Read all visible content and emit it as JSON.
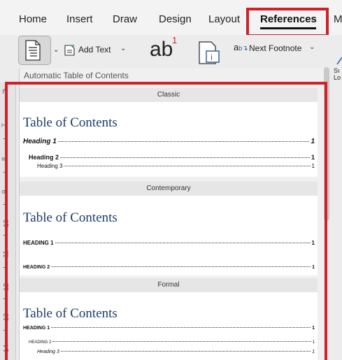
{
  "ribbon": {
    "tabs": [
      {
        "label": "Home"
      },
      {
        "label": "Insert"
      },
      {
        "label": "Draw"
      },
      {
        "label": "Design"
      },
      {
        "label": "Layout"
      },
      {
        "label": "References",
        "active": true
      },
      {
        "label": "M"
      }
    ],
    "add_text_label": "Add Text",
    "footnote_glyph": "ab",
    "footnote_superscript": "1",
    "next_footnote_label": "Next Footnote",
    "cut_off_text": "Sı\nLo"
  },
  "gallery": {
    "header": "Automatic Table of Contents",
    "ruler_numbers": [
      "7",
      "8",
      "9",
      "10",
      "11",
      "12",
      "13",
      "14"
    ],
    "styles": [
      {
        "label": "Classic",
        "title": "Table of Contents",
        "entries": [
          {
            "text": "Heading 1",
            "page": "1"
          },
          {
            "text": "Heading 2",
            "page": "1"
          },
          {
            "text": "Heading 3",
            "page": "1"
          }
        ]
      },
      {
        "label": "Contemporary",
        "title": "Table of Contents",
        "entries": [
          {
            "text": "HEADING 1",
            "page": "1"
          },
          {
            "text": "HEADING 2",
            "page": "1"
          }
        ]
      },
      {
        "label": "Formal",
        "title": "Table of Contents",
        "entries": [
          {
            "text": "HEADING 1",
            "page": "1"
          },
          {
            "text": "HEADING 2",
            "page": "1"
          },
          {
            "text": "Heading 3",
            "page": "1"
          }
        ]
      }
    ]
  },
  "colors": {
    "highlight": "#d0202a",
    "toc_title": "#1d3b66",
    "accent": "#2b579a"
  }
}
